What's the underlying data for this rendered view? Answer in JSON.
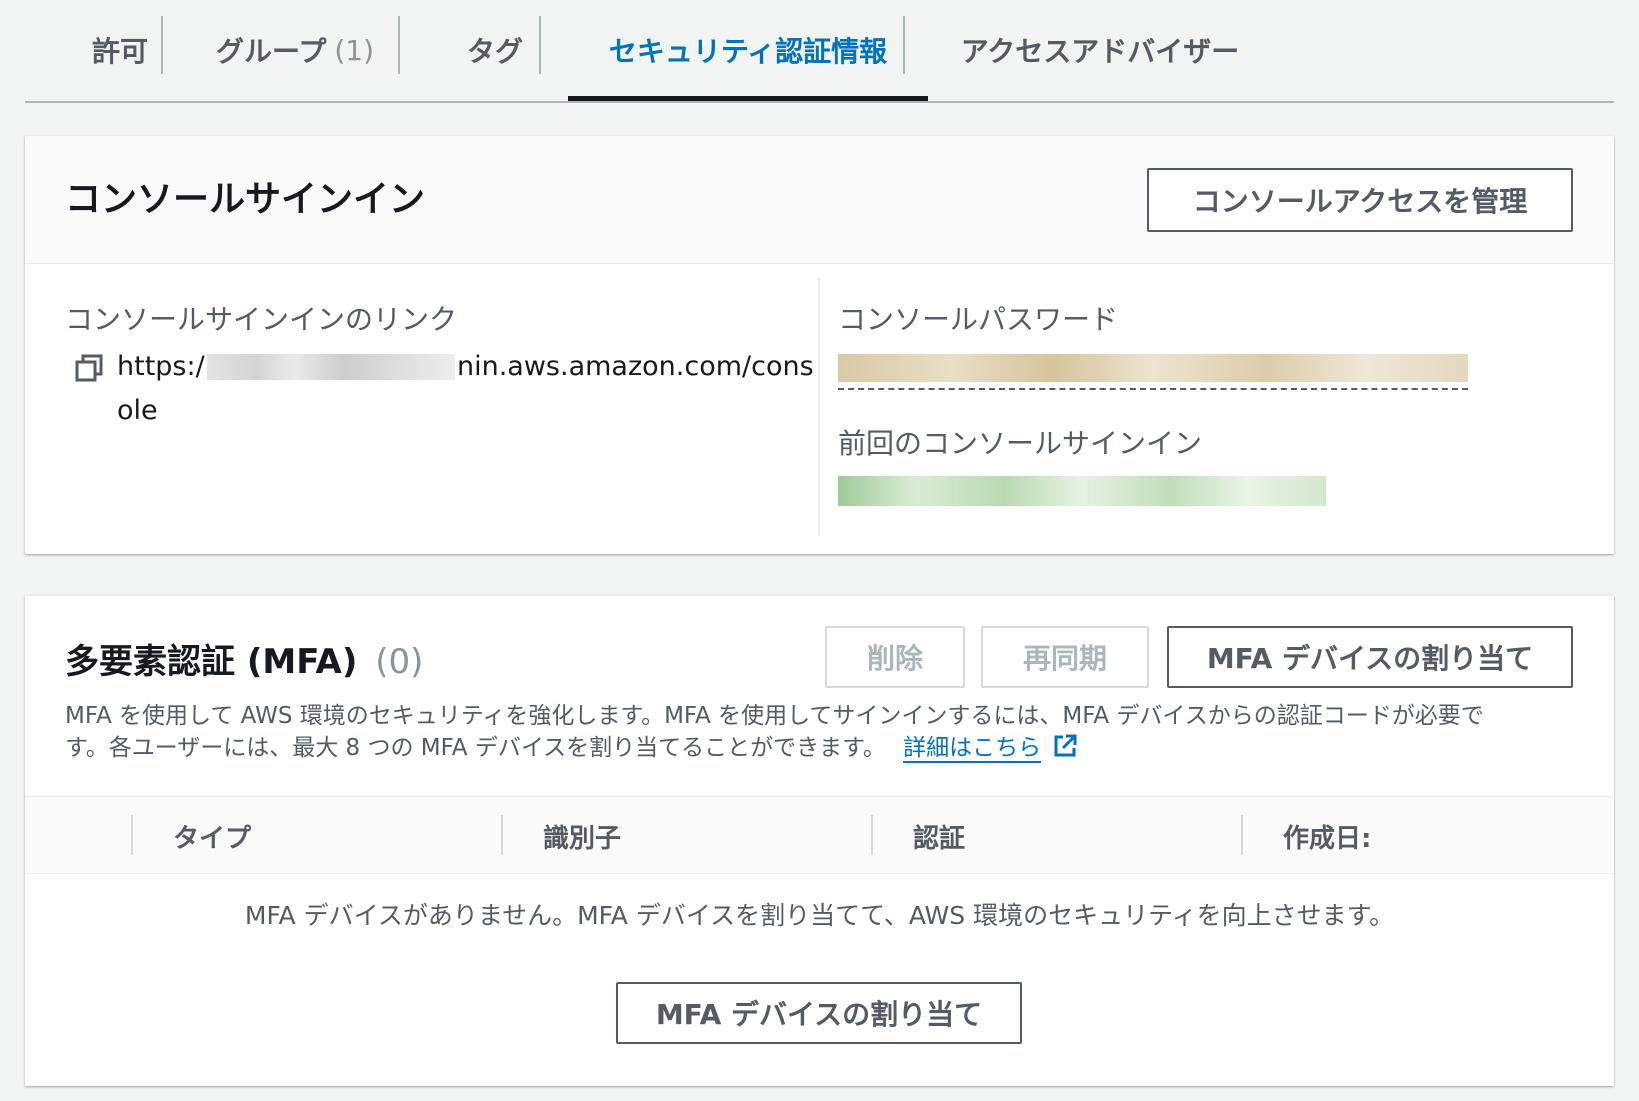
{
  "tabs": [
    {
      "label": "許可",
      "count": ""
    },
    {
      "label": "グループ",
      "count": "(1)"
    },
    {
      "label": "タグ",
      "count": ""
    },
    {
      "label": "セキュリティ認証情報",
      "count": ""
    },
    {
      "label": "アクセスアドバイザー",
      "count": ""
    }
  ],
  "console_signin": {
    "title": "コンソールサインイン",
    "manage_button": "コンソールアクセスを管理",
    "link_label": "コンソールサインインのリンク",
    "link_prefix": "https:/",
    "link_suffix": "nin.aws.amazon.com/cons",
    "link_wrap": "ole",
    "password_label": "コンソールパスワード",
    "last_signin_label": "前回のコンソールサインイン"
  },
  "mfa": {
    "title": "多要素認証 (MFA)",
    "count": "(0)",
    "delete_button": "削除",
    "resync_button": "再同期",
    "assign_button": "MFA デバイスの割り当て",
    "description_line1": "MFA を使用して AWS 環境のセキュリティを強化します。MFA を使用してサインインするには、MFA デバイスからの認証コードが必要で",
    "description_line2": "す。各ユーザーには、最大 8 つの MFA デバイスを割り当てることができます。",
    "learn_more": "詳細はこちら",
    "columns": [
      "タイプ",
      "識別子",
      "認証",
      "作成日:"
    ],
    "empty_message": "MFA デバイスがありません。MFA デバイスを割り当てて、AWS 環境のセキュリティを向上させます。",
    "empty_assign_button": "MFA デバイスの割り当て"
  },
  "colors": {
    "accent": "#0073bb",
    "text": "#16191f",
    "muted": "#545b64",
    "background": "#f2f3f3"
  }
}
